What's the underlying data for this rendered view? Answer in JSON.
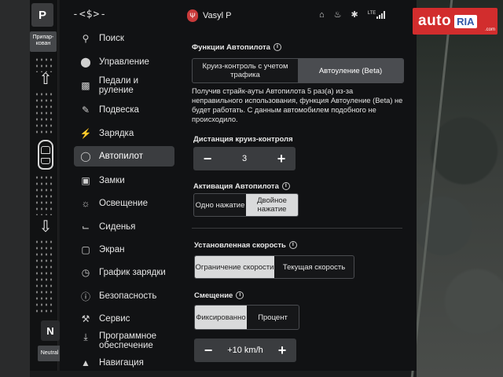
{
  "gear": {
    "park": "P",
    "park_label": "Припар-кован",
    "neutral": "N",
    "neutral_label": "Neutral"
  },
  "nav": {
    "top_glyph": "-<$>-"
  },
  "sidebar": {
    "items": [
      {
        "label": "Поиск",
        "icon": "search-icon"
      },
      {
        "label": "Управление",
        "icon": "toggle-icon"
      },
      {
        "label": "Педали и руление",
        "icon": "car-icon"
      },
      {
        "label": "Подвеска",
        "icon": "wrench-icon"
      },
      {
        "label": "Зарядка",
        "icon": "bolt-icon"
      },
      {
        "label": "Автопилот",
        "icon": "steering-wheel-icon",
        "active": true
      },
      {
        "label": "Замки",
        "icon": "lock-icon"
      },
      {
        "label": "Освещение",
        "icon": "sun-icon"
      },
      {
        "label": "Сиденья",
        "icon": "seat-icon"
      },
      {
        "label": "Экран",
        "icon": "display-icon"
      },
      {
        "label": "График зарядки",
        "icon": "clock-icon"
      },
      {
        "label": "Безопасность",
        "icon": "info-icon"
      },
      {
        "label": "Сервис",
        "icon": "tools-icon"
      },
      {
        "label": "Программное обеспечение",
        "icon": "download-icon"
      },
      {
        "label": "Навигация",
        "icon": "navigation-icon"
      }
    ]
  },
  "header": {
    "user_initial": "Ψ",
    "user_name": "Vasyl P",
    "lte": "LTE"
  },
  "badge": {
    "auto": "auto",
    "ria": "RIA",
    "com": ".com"
  },
  "autopilot": {
    "features_title": "Функции Автопилота",
    "features_options": [
      "Круиз-контроль с учетом трафика",
      "Автоуление (Beta)"
    ],
    "features_selected": 1,
    "strike_text": "Получив страйк-ауты Автопилота 5 раз(а) из-за неправильного использования, функция Автоуление (Beta) не будет работать. С данным автомобилем подобного не происходило.",
    "distance_title": "Дистанция круиз-контроля",
    "distance_value": "3",
    "activation_title": "Активация Автопилота",
    "activation_options": [
      "Одно нажатие",
      "Двойное нажатие"
    ],
    "activation_selected": 1,
    "speed_title": "Установленная скорость",
    "speed_options": [
      "Ограничение скорости",
      "Текущая скорость"
    ],
    "speed_selected": 0,
    "offset_title": "Смещение",
    "offset_options": [
      "Фиксированно",
      "Процент"
    ],
    "offset_selected": 0,
    "offset_value": "+10 km/h",
    "minus": "−",
    "plus": "+"
  }
}
